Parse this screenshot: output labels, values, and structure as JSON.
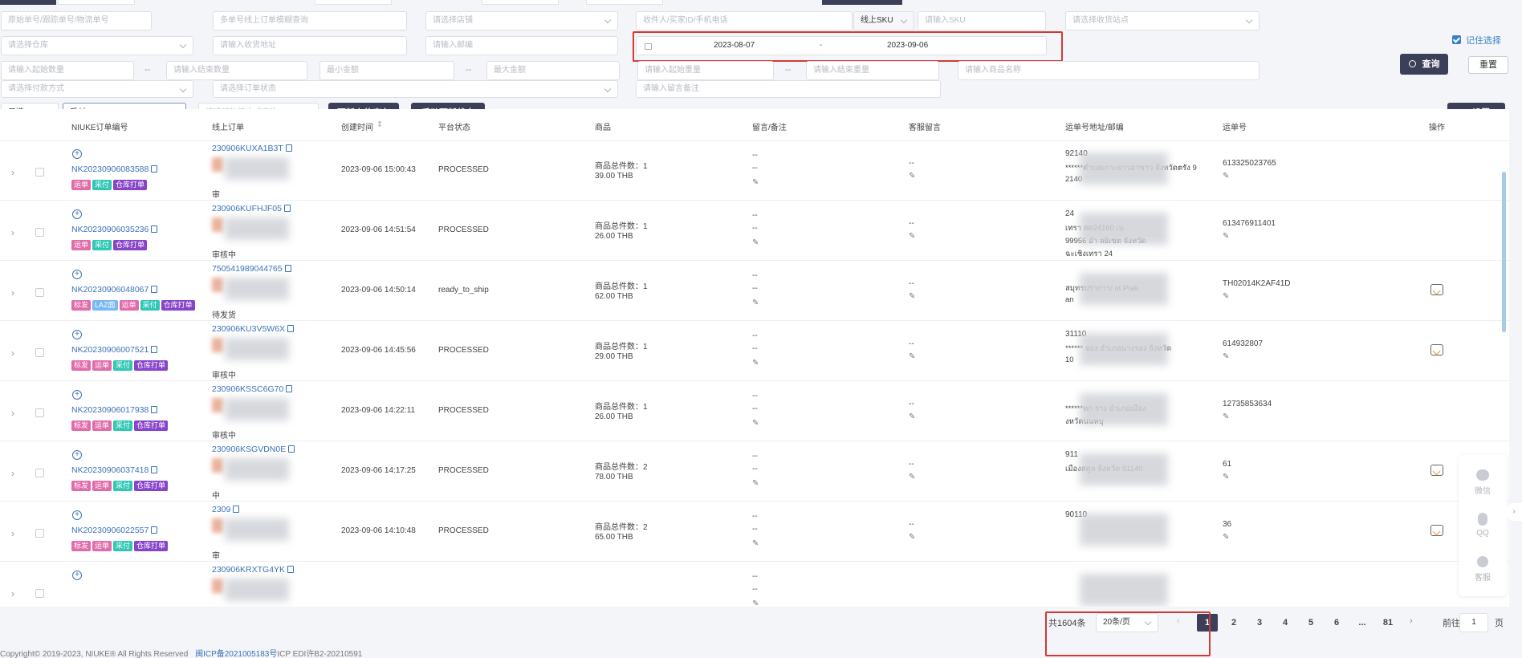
{
  "filters": {
    "row1": {
      "order_no_placeholder": "原始单号/跟踪单号/物流单号",
      "multi_online_placeholder": "多单号线上订单模糊查询",
      "store_placeholder": "请选择店铺",
      "receiver_placeholder": "收件人/买家ID/手机电话",
      "sku_type": "线上SKU",
      "sku_placeholder": "请输入SKU",
      "logistics_point_placeholder": "请选择收货站点"
    },
    "row2": {
      "warehouse_placeholder": "请选择仓库",
      "address_placeholder": "请输入收货地址",
      "zip_placeholder": "请输入邮编",
      "date_start": "2023-08-07",
      "date_sep": "-",
      "date_end": "2023-09-06"
    },
    "row3": {
      "min_qty_placeholder": "请输入起始数量",
      "max_qty_placeholder": "请输入结束数量",
      "min_amount_placeholder": "最小金额",
      "max_amount_placeholder": "最大金额",
      "min_weight_placeholder": "请输入起始重量",
      "max_weight_placeholder": "请输入结束重量",
      "product_name_placeholder": "请输入商品名称",
      "range_sep": "--"
    },
    "row4": {
      "payment_placeholder": "请选择付款方式",
      "order_status_placeholder": "请选择订单状态",
      "remark_placeholder": "请输入留言备注"
    },
    "row5": {
      "mode_value": "只选",
      "type_value": "采付",
      "logistics_method_placeholder": "请选择物流方式查询"
    }
  },
  "buttons": {
    "update_stock": "更新占位库存",
    "manual_update": "手动更新状态",
    "query": "查询",
    "reset": "重置",
    "settings": "设置"
  },
  "remember_label": "记住选择",
  "columns": [
    "NIUKE订单编号",
    "线上订单",
    "创建时间",
    "平台状态",
    "商品",
    "留言/备注",
    "客服留言",
    "运单号地址/邮编",
    "运单号",
    "操作"
  ],
  "rows": [
    {
      "niuke_id": "NK20230906083588",
      "online_id": "230906KUXA1B3T",
      "online_sub": "审",
      "created": "2023-09-06 15:00:43",
      "status": "PROCESSED",
      "qty_label": "商品总件数：1",
      "amount": "39.00 THB",
      "msg1": "--",
      "msg2": "--",
      "cs": "--",
      "zip": "92140",
      "addr1": "******ตำบลเกาะยาวอาซาว จังหวัดตรัง 9",
      "addr2": "2140",
      "tracking": "613325023765",
      "tags": [
        {
          "t": "运单",
          "c": "pink"
        },
        {
          "t": "采付",
          "c": "teal"
        },
        {
          "t": "仓库打单",
          "c": "purple"
        }
      ],
      "op": false
    },
    {
      "niuke_id": "NK20230906035236",
      "online_id": "230906KUFHJF05",
      "online_sub": "审核中",
      "created": "2023-09-06 14:51:54",
      "status": "PROCESSED",
      "qty_label": "商品总件数：1",
      "amount": "26.00 THB",
      "msg1": "--",
      "msg2": "--",
      "cs": "--",
      "zip": "24",
      "addr1": "เทรา ลด24160 เบ",
      "addr2": "99956 อำ ลยิเซต จังหวัด",
      "addr3": "ฉะเชิงเทรา 24",
      "tracking": "613476911401",
      "tags": [
        {
          "t": "运单",
          "c": "pink"
        },
        {
          "t": "采付",
          "c": "teal"
        },
        {
          "t": "仓库打单",
          "c": "purple"
        }
      ],
      "op": false
    },
    {
      "niuke_id": "NK20230906048067",
      "online_id": "750541989044765",
      "online_sub": "待发货",
      "created": "2023-09-06 14:50:14",
      "status": "ready_to_ship",
      "qty_label": "商品总件数：1",
      "amount": "62.00 THB",
      "msg1": "--",
      "msg2": "--",
      "cs": "--",
      "zip": "",
      "addr1": "สมุทรปราการ/ ut Prak",
      "addr2": "an",
      "tracking": "TH02014K2AF41D",
      "tags": [
        {
          "t": "标发",
          "c": "pink"
        },
        {
          "t": "LAZ面",
          "c": "lblue"
        },
        {
          "t": "运单",
          "c": "pink"
        },
        {
          "t": "采付",
          "c": "teal"
        },
        {
          "t": "仓库打单",
          "c": "purple"
        }
      ],
      "op": true
    },
    {
      "niuke_id": "NK20230906007521",
      "online_id": "230906KU3V5W6X",
      "online_sub": "审核中",
      "created": "2023-09-06 14:45:56",
      "status": "PROCESSED",
      "qty_label": "商品总件数：1",
      "amount": "29.00 THB",
      "msg1": "--",
      "msg2": "--",
      "cs": "--",
      "zip": "31110",
      "addr1": "****** จอง อำเภอนางรอง จังหวัด",
      "addr2": "10",
      "tracking": "614932807",
      "tags": [
        {
          "t": "标发",
          "c": "pink"
        },
        {
          "t": "运单",
          "c": "pink"
        },
        {
          "t": "采付",
          "c": "teal"
        },
        {
          "t": "仓库打单",
          "c": "purple"
        }
      ],
      "op": true
    },
    {
      "niuke_id": "NK20230906017938",
      "online_id": "230906KSSC6G70",
      "online_sub": "审核中",
      "created": "2023-09-06 14:22:11",
      "status": "PROCESSED",
      "qty_label": "商品总件数：1",
      "amount": "26.00 THB",
      "msg1": "--",
      "msg2": "--",
      "cs": "--",
      "zip": "",
      "addr1": "******หก ราง อำเภอเมือง",
      "addr2": "งหวัดนนทบุ",
      "tracking": "12735853634",
      "tags": [
        {
          "t": "标发",
          "c": "pink"
        },
        {
          "t": "运单",
          "c": "pink"
        },
        {
          "t": "采付",
          "c": "teal"
        },
        {
          "t": "仓库打单",
          "c": "purple"
        }
      ],
      "op": false
    },
    {
      "niuke_id": "NK20230906037418",
      "online_id": "230906KSGVDN0E",
      "online_sub": "中",
      "created": "2023-09-06 14:17:25",
      "status": "PROCESSED",
      "qty_label": "商品总件数：2",
      "amount": "78.00 THB",
      "msg1": "--",
      "msg2": "--",
      "cs": "--",
      "zip": "911",
      "addr1": "เมืองสตูล จังหวัด 91140",
      "addr2": "",
      "tracking": "61",
      "tags": [
        {
          "t": "标发",
          "c": "pink"
        },
        {
          "t": "运单",
          "c": "pink"
        },
        {
          "t": "采付",
          "c": "teal"
        },
        {
          "t": "仓库打单",
          "c": "purple"
        }
      ],
      "op": true
    },
    {
      "niuke_id": "NK20230906022557",
      "online_id": "2309",
      "online_sub": "审",
      "created": "2023-09-06 14:10:48",
      "status": "PROCESSED",
      "qty_label": "商品总件数：2",
      "amount": "65.00 THB",
      "msg1": "--",
      "msg2": "--",
      "cs": "--",
      "zip": "90110",
      "addr1": "",
      "addr2": "",
      "tracking": "36",
      "tags": [
        {
          "t": "标发",
          "c": "pink"
        },
        {
          "t": "运单",
          "c": "pink"
        },
        {
          "t": "采付",
          "c": "teal"
        },
        {
          "t": "仓库打单",
          "c": "purple"
        }
      ],
      "op": true
    },
    {
      "niuke_id": "",
      "online_id": "230906KRXTG4YK",
      "online_sub": "",
      "created": "",
      "status": "",
      "qty_label": "",
      "amount": "",
      "msg1": "--",
      "msg2": "--",
      "cs": "",
      "zip": "",
      "addr1": "",
      "addr2": "",
      "tracking": "",
      "tags": [],
      "op": false
    }
  ],
  "pagination": {
    "total": "共1604条",
    "page_size": "20条/页",
    "pages": [
      "1",
      "2",
      "3",
      "4",
      "5",
      "6",
      "...",
      "81"
    ],
    "goto_label": "前往",
    "goto_value": "1",
    "page_suffix": "页"
  },
  "float_bar": {
    "wechat": "微信",
    "qq": "QQ",
    "service": "客服"
  },
  "footer": {
    "copyright": "Copyright© 2019-2023, NIUKE® All Rights Reserved",
    "icp": "闽ICP备2021005183号",
    "icp_extra": "ICP EDI许B2-20210591"
  }
}
